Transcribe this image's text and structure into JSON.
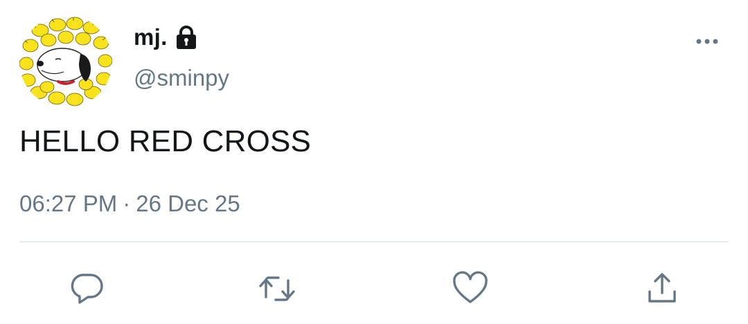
{
  "user": {
    "display_name": "mj.",
    "handle": "@sminpy",
    "avatar_icon": "snoopy-woodstock-avatar",
    "protected_icon": "lock-icon"
  },
  "tweet": {
    "text": "HELLO RED CROSS",
    "time": "06:27 PM",
    "separator": "·",
    "date": "26 Dec 25"
  },
  "actions": {
    "reply_icon": "reply-icon",
    "retweet_icon": "retweet-icon",
    "like_icon": "heart-icon",
    "share_icon": "share-icon",
    "more_icon": "more-icon"
  },
  "colors": {
    "text_primary": "#14171a",
    "text_secondary": "#657786",
    "divider": "#e6ecf0",
    "icon": "#657786",
    "avatar_yellow": "#f7e21c"
  }
}
